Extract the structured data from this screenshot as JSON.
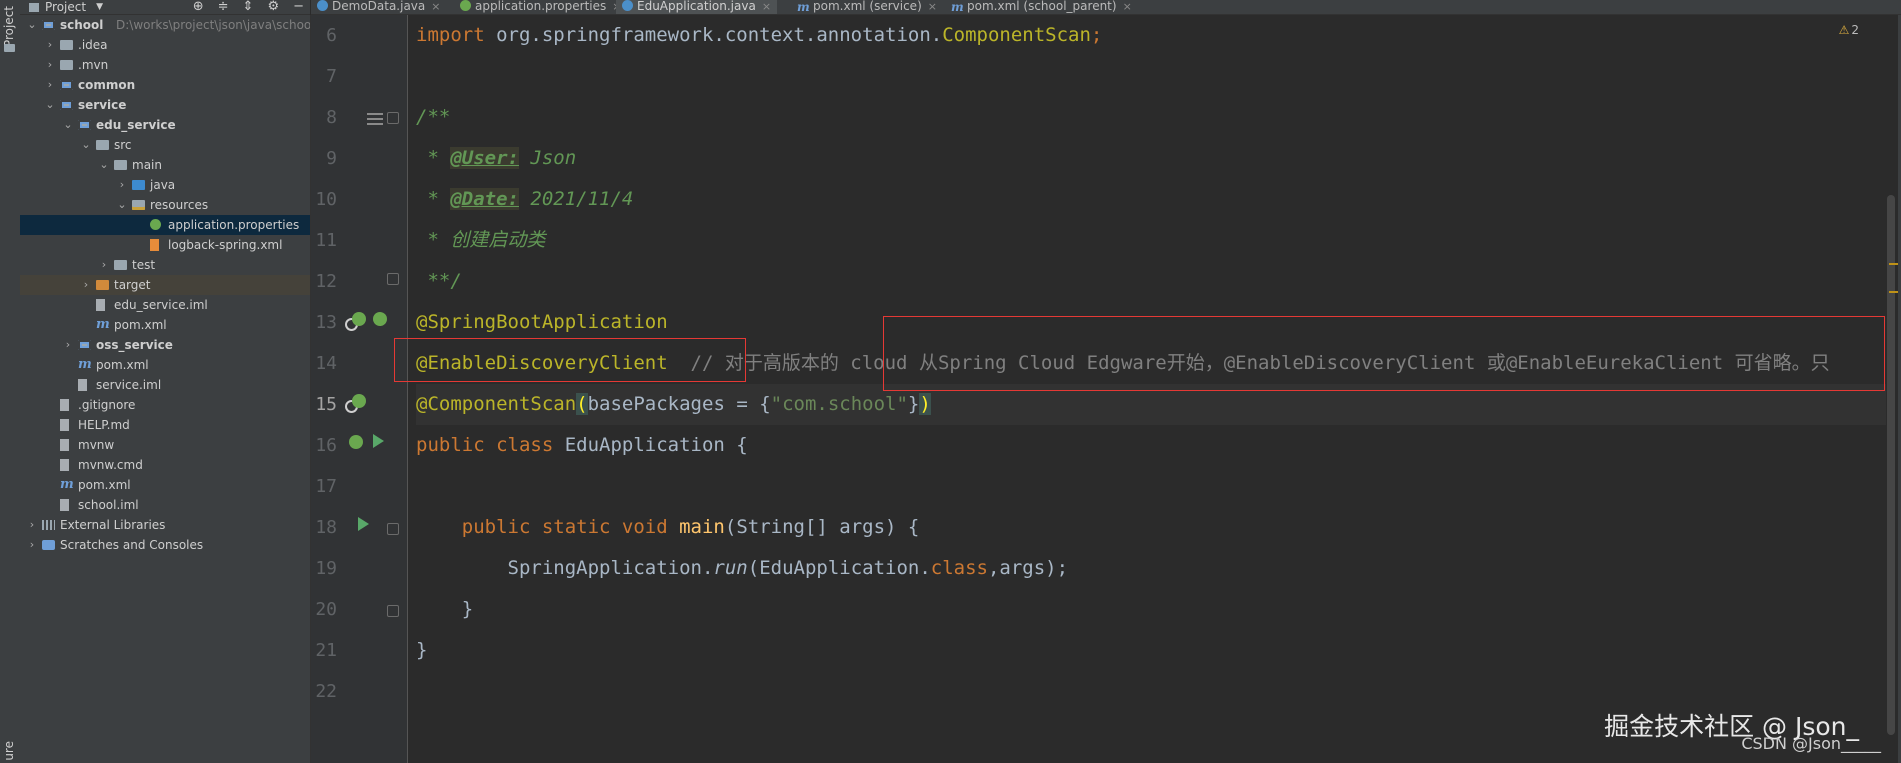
{
  "tool_strip": {
    "project_label": "Project",
    "bottom_label": "ure"
  },
  "project_header": {
    "title": "Project",
    "dropdown": "▼"
  },
  "tree": [
    {
      "label": "school",
      "hint": "D:\\works\\project\\json\\java\\school",
      "bold": true,
      "icon": "module",
      "arrow": "v",
      "indent": 0
    },
    {
      "label": ".idea",
      "icon": "folder",
      "arrow": ">",
      "indent": 1
    },
    {
      "label": ".mvn",
      "icon": "folder",
      "arrow": ">",
      "indent": 1
    },
    {
      "label": "common",
      "bold": true,
      "icon": "module",
      "arrow": ">",
      "indent": 1
    },
    {
      "label": "service",
      "bold": true,
      "icon": "module",
      "arrow": "v",
      "indent": 1
    },
    {
      "label": "edu_service",
      "bold": true,
      "icon": "module",
      "arrow": "v",
      "indent": 2
    },
    {
      "label": "src",
      "icon": "folder",
      "arrow": "v",
      "indent": 3
    },
    {
      "label": "main",
      "icon": "folder",
      "arrow": "v",
      "indent": 4
    },
    {
      "label": "java",
      "icon": "folder-blue",
      "arrow": ">",
      "indent": 5
    },
    {
      "label": "resources",
      "icon": "folder-res",
      "arrow": "v",
      "indent": 5
    },
    {
      "label": "application.properties",
      "icon": "file-props",
      "arrow": "",
      "indent": 6,
      "selected": true
    },
    {
      "label": "logback-spring.xml",
      "icon": "file-xml",
      "arrow": "",
      "indent": 6
    },
    {
      "label": "test",
      "icon": "folder",
      "arrow": ">",
      "indent": 4
    },
    {
      "label": "target",
      "icon": "folder-orange",
      "arrow": ">",
      "indent": 3,
      "excluded": true
    },
    {
      "label": "edu_service.iml",
      "icon": "file",
      "arrow": "",
      "indent": 3
    },
    {
      "label": "pom.xml",
      "icon": "file-m",
      "arrow": "",
      "indent": 3
    },
    {
      "label": "oss_service",
      "bold": true,
      "icon": "module",
      "arrow": ">",
      "indent": 2
    },
    {
      "label": "pom.xml",
      "icon": "file-m",
      "arrow": "",
      "indent": 2
    },
    {
      "label": "service.iml",
      "icon": "file",
      "arrow": "",
      "indent": 2
    },
    {
      "label": ".gitignore",
      "icon": "file",
      "arrow": "",
      "indent": 1
    },
    {
      "label": "HELP.md",
      "icon": "file",
      "arrow": "",
      "indent": 1
    },
    {
      "label": "mvnw",
      "icon": "file",
      "arrow": "",
      "indent": 1
    },
    {
      "label": "mvnw.cmd",
      "icon": "file",
      "arrow": "",
      "indent": 1
    },
    {
      "label": "pom.xml",
      "icon": "file-m",
      "arrow": "",
      "indent": 1
    },
    {
      "label": "school.iml",
      "icon": "file",
      "arrow": "",
      "indent": 1
    },
    {
      "label": "External Libraries",
      "icon": "lib",
      "arrow": ">",
      "indent": 0
    },
    {
      "label": "Scratches and Consoles",
      "icon": "scratch",
      "arrow": ">",
      "indent": 0
    }
  ],
  "tabs": [
    {
      "label": "DemoData.java",
      "icon": "java",
      "active": false
    },
    {
      "label": "application.properties",
      "icon": "props",
      "active": false
    },
    {
      "label": "EduApplication.java",
      "icon": "java",
      "active": true
    },
    {
      "label": "pom.xml (service)",
      "icon": "m",
      "active": false
    },
    {
      "label": "pom.xml (school_parent)",
      "icon": "m",
      "active": false
    }
  ],
  "tab_close": "×",
  "line_numbers": [
    "6",
    "7",
    "8",
    "9",
    "10",
    "11",
    "12",
    "13",
    "14",
    "15",
    "16",
    "17",
    "18",
    "19",
    "20",
    "21",
    "22"
  ],
  "code": {
    "l6_import": "import ",
    "l6_pkg": "org.springframework.context.annotation.",
    "l6_cls": "ComponentScan",
    "l6_semi": ";",
    "l8": "/**",
    "l9_star": " * ",
    "l9_tag": "@User:",
    "l9_val": " Json",
    "l10_star": " * ",
    "l10_tag": "@Date:",
    "l10_val": " 2021/11/4",
    "l11": " * 创建启动类",
    "l12": " **/",
    "l13": "@SpringBootApplication",
    "l14_ann": "@EnableDiscoveryClient",
    "l14_cmt": "  // 对于高版本的 cloud 从Spring Cloud Edgware开始，@EnableDiscoveryClient 或@EnableEurekaClient 可省略。只",
    "l15_ann": "@ComponentScan",
    "l15_open": "(",
    "l15_key": "basePackages = {",
    "l15_str": "\"com.school\"",
    "l15_brace": "}",
    "l15_close": ")",
    "l16_kw": "public class ",
    "l16_name": "EduApplication {",
    "l18_kw": "    public static void ",
    "l18_method": "main",
    "l18_args": "(String[] args) {",
    "l19_pre": "        SpringApplication.",
    "l19_run": "run",
    "l19_mid": "(EduApplication.",
    "l19_class": "class",
    "l19_end": ",args);",
    "l20": "    }",
    "l21": "}"
  },
  "warnings": {
    "icon": "⚠",
    "count": "2"
  },
  "watermarks": {
    "juejin": "掘金技术社区 @ Json_",
    "csdn": "CSDN @Json_____"
  },
  "colors": {
    "accent_selected": "#0d293e",
    "annotation": "#bbb529",
    "keyword": "#cc7832",
    "string": "#6a8759",
    "highlight_box": "#e53935"
  }
}
